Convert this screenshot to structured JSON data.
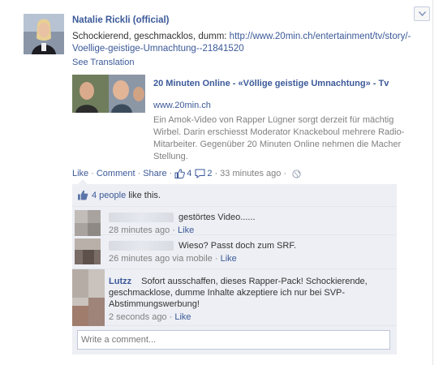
{
  "post": {
    "author": "Natalie Rickli (official)",
    "message_line1": "Schockierend, geschmacklos, dumm: ",
    "message_link": "http://www.20min.ch/entertainment/tv/story/-Voellige-geistige-Umnachtung--21841520",
    "see_translation": "See Translation"
  },
  "share": {
    "title": "20 Minuten Online - «Völlige geistige Umnachtung» - Tv",
    "domain": "www.20min.ch",
    "description": "Ein Amok-Video von Rapper Lügner sorgt derzeit für mächtig Wirbel. Darin erschiesst Moderator Knackeboul mehrere Radio-Mitarbeiter. Gegenüber 20 Minuten Online nehmen die Macher Stellung."
  },
  "actions": {
    "like": "Like",
    "comment": "Comment",
    "share": "Share",
    "like_count": "4",
    "comment_count": "2",
    "time": "33 minutes ago"
  },
  "likes": {
    "people": "4 people",
    "suffix": "like this."
  },
  "comments": [
    {
      "text": "gestörtes Video......",
      "time": "28 minutes ago",
      "like": "Like"
    },
    {
      "text": "Wieso? Passt doch zum SRF.",
      "time": "26 minutes ago via mobile",
      "like": "Like"
    },
    {
      "name": "Lutzz",
      "text": "Sofort ausschaffen, dieses Rapper-Pack! Schockierende, geschmacklose, dumme Inhalte akzeptiere ich nur bei SVP-Abstimmungswerbung!",
      "time": "2 seconds ago",
      "like": "Like"
    }
  ],
  "write_comment": {
    "placeholder": "Write a comment..."
  },
  "colors": {
    "link": "#3b5998",
    "ufi_background": "#edeff4"
  }
}
